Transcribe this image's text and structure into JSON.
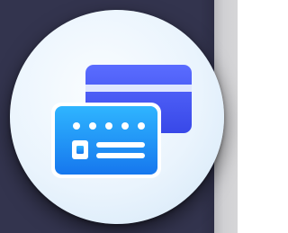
{
  "icon": {
    "name": "credit-cards-icon",
    "back_card": {
      "fill_top": "#5a6cff",
      "fill_bottom": "#3848e8",
      "stripe": "#dfe6ff"
    },
    "front_card": {
      "fill_top": "#2fb5ff",
      "fill_bottom": "#1677ee",
      "details": "#ffffff"
    }
  },
  "colors": {
    "background": "#33344e",
    "badge": "#e8f3fc"
  }
}
